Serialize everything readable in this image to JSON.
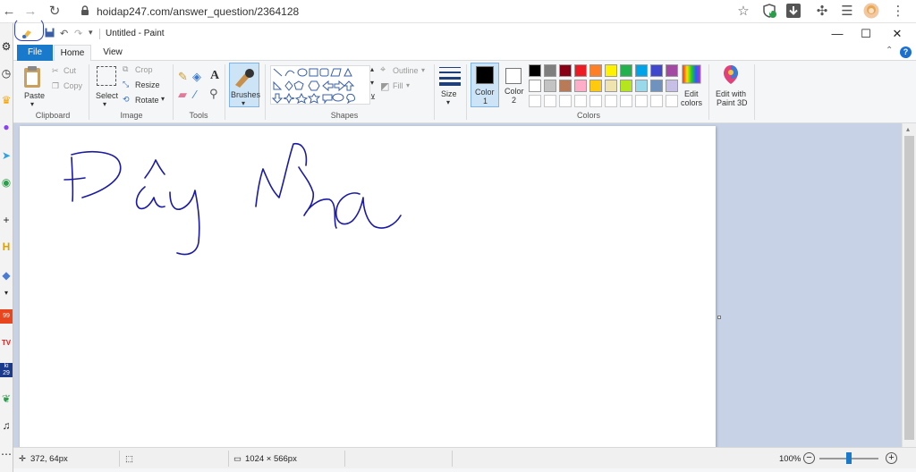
{
  "browser": {
    "url": "hoidap247.com/answer_question/2364128",
    "shield_badge": "7"
  },
  "sidebar": {
    "badges": [
      "99",
      "29"
    ],
    "text_tiles": [
      "H",
      "TV",
      "ki"
    ]
  },
  "paint": {
    "window_title": "Untitled - Paint",
    "tabs": {
      "file": "File",
      "home": "Home",
      "view": "View"
    },
    "clipboard": {
      "paste": "Paste",
      "cut": "Cut",
      "copy": "Copy",
      "group": "Clipboard"
    },
    "image": {
      "select": "Select",
      "crop": "Crop",
      "resize": "Resize",
      "rotate": "Rotate",
      "group": "Image"
    },
    "tools": {
      "group": "Tools",
      "text_tool": "A"
    },
    "brushes": {
      "label": "Brushes"
    },
    "shapes": {
      "outline": "Outline",
      "fill": "Fill",
      "group": "Shapes"
    },
    "size": {
      "label": "Size"
    },
    "colors": {
      "color1_label": "Color",
      "color1_index": "1",
      "color2_label": "Color",
      "color2_index": "2",
      "color1_value": "#000000",
      "color2_value": "#ffffff",
      "palette_row1": [
        "#000000",
        "#7f7f7f",
        "#880015",
        "#ed1c24",
        "#ff7f27",
        "#fff200",
        "#22b14c",
        "#00a2e8",
        "#3f48cc",
        "#a349a4"
      ],
      "palette_row2": [
        "#ffffff",
        "#c3c3c3",
        "#b97a57",
        "#ffaec9",
        "#ffc90e",
        "#efe4b0",
        "#b5e61d",
        "#99d9ea",
        "#7092be",
        "#c8bfe7"
      ],
      "edit_colors_line1": "Edit",
      "edit_colors_line2": "colors",
      "paint3d_line1": "Edit with",
      "paint3d_line2": "Paint 3D",
      "group": "Colors"
    },
    "status": {
      "cursor_pos": "372, 64px",
      "image_size": "1024 × 566px",
      "zoom": "100%",
      "zoom_level": 0.5
    },
    "accent": "#1979ca",
    "ink_color": "#1a1aa6"
  }
}
